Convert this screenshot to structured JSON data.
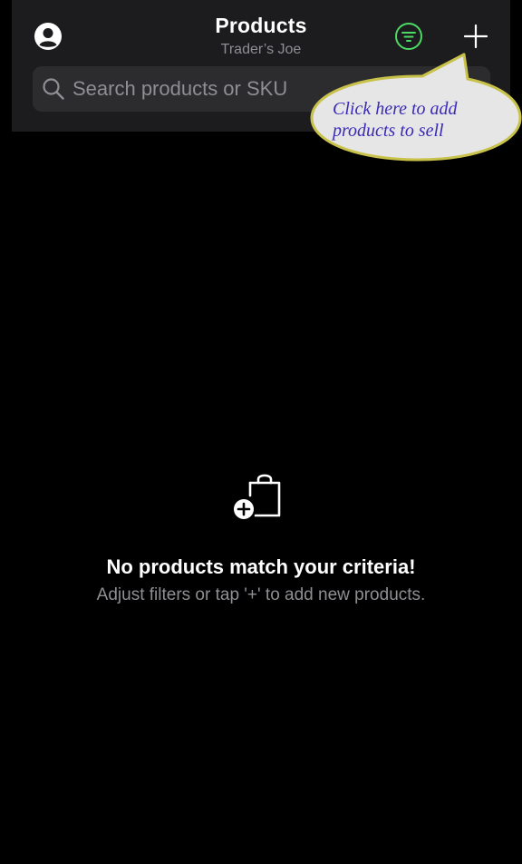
{
  "header": {
    "title": "Products",
    "subtitle": "Trader’s Joe",
    "accent_color": "#4cd964"
  },
  "icons": {
    "profile": "person-circle-icon",
    "filter": "filter-icon",
    "add": "plus-icon",
    "search": "search-icon",
    "empty_state": "add-bag-icon"
  },
  "search": {
    "placeholder": "Search products or SKU",
    "value": ""
  },
  "callout": {
    "line1": "Click here to add",
    "line2": "products to sell",
    "fill_color": "#e6e6e6",
    "border_color": "#c8c24a",
    "text_color": "#3b2ab8"
  },
  "empty_state": {
    "title": "No products match your criteria!",
    "subtitle": "Adjust filters or tap '+' to add new products."
  }
}
